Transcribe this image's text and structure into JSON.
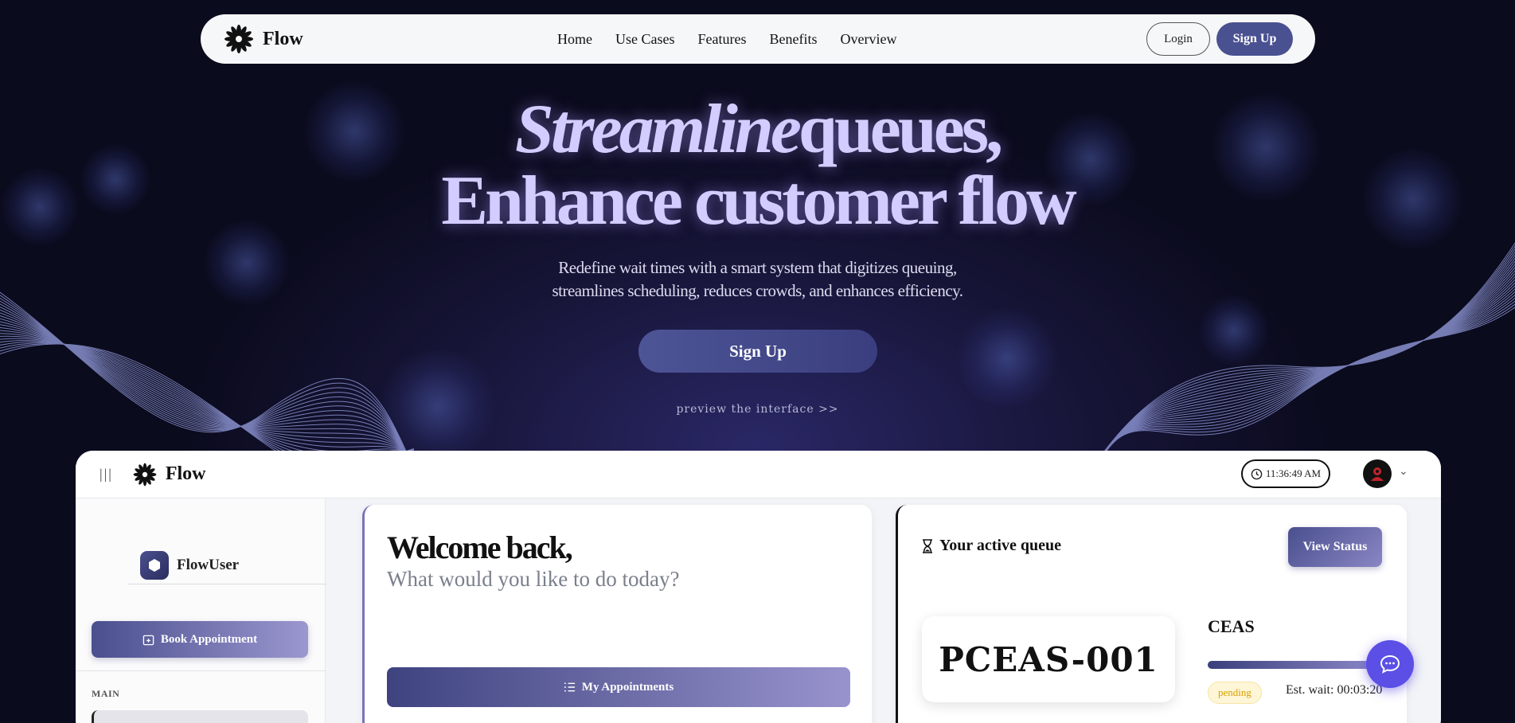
{
  "nav": {
    "brand": "Flow",
    "links": [
      "Home",
      "Use Cases",
      "Features",
      "Benefits",
      "Overview"
    ],
    "login": "Login",
    "signup": "Sign Up"
  },
  "hero": {
    "title_italic": "Streamline",
    "title_rest": "queues,",
    "title_line2": "Enhance customer flow",
    "subtitle_line1": "Redefine wait times with a smart system that digitizes queuing,",
    "subtitle_line2": "streamlines scheduling, reduces crowds, and enhances efficiency.",
    "cta": "Sign Up",
    "preview": "preview the interface >>"
  },
  "app": {
    "brand": "Flow",
    "clock": "11:36:49 AM",
    "user_name": "FlowUser",
    "book_button": "Book Appointment",
    "section_main": "MAIN",
    "welcome_title": "Welcome back,",
    "welcome_sub": "What would you like to do today?",
    "my_appointments": "My Appointments",
    "queue_title": "Your active queue",
    "view_status": "View Status",
    "ticket": "PCEAS-001",
    "service": "CEAS",
    "status": "pending",
    "est_wait": "Est. wait: 00:03:20"
  },
  "colors": {
    "background": "#0b0b1e",
    "accent": "#4a5191",
    "hero_text": "#d3ccff",
    "chat_fab": "#5b4fe6",
    "pending": "#d6a100"
  }
}
